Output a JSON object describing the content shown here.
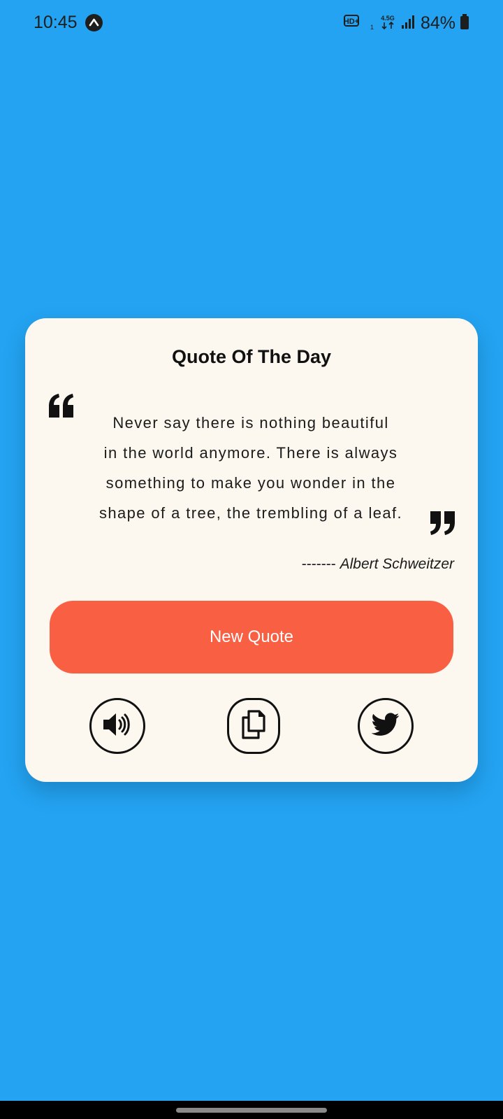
{
  "status_bar": {
    "time": "10:45",
    "app_icon": "arrow-up-circle-icon",
    "network_label": "HD+",
    "network_sub": "1",
    "network_type": "4.5G",
    "signal_icon": "signal-icon",
    "battery_percent": "84%",
    "battery_icon": "battery-icon"
  },
  "card": {
    "title": "Quote Of The Day",
    "quote_open_icon": "quote-open-icon",
    "quote_close_icon": "quote-close-icon",
    "quote_lines": [
      "Never say there is nothing beautiful",
      "in the world anymore. There is always",
      "something to make you wonder in the",
      "shape of a tree, the trembling of a leaf."
    ],
    "author_prefix": "-------",
    "author": "Albert Schweitzer",
    "new_quote_label": "New Quote",
    "actions": [
      {
        "name": "speak",
        "icon": "speaker-icon"
      },
      {
        "name": "copy",
        "icon": "copy-icon"
      },
      {
        "name": "tweet",
        "icon": "twitter-icon"
      }
    ]
  },
  "colors": {
    "background": "#23a3f2",
    "card": "#fcf8ef",
    "button": "#f85f43",
    "text": "#1b1b1b"
  }
}
